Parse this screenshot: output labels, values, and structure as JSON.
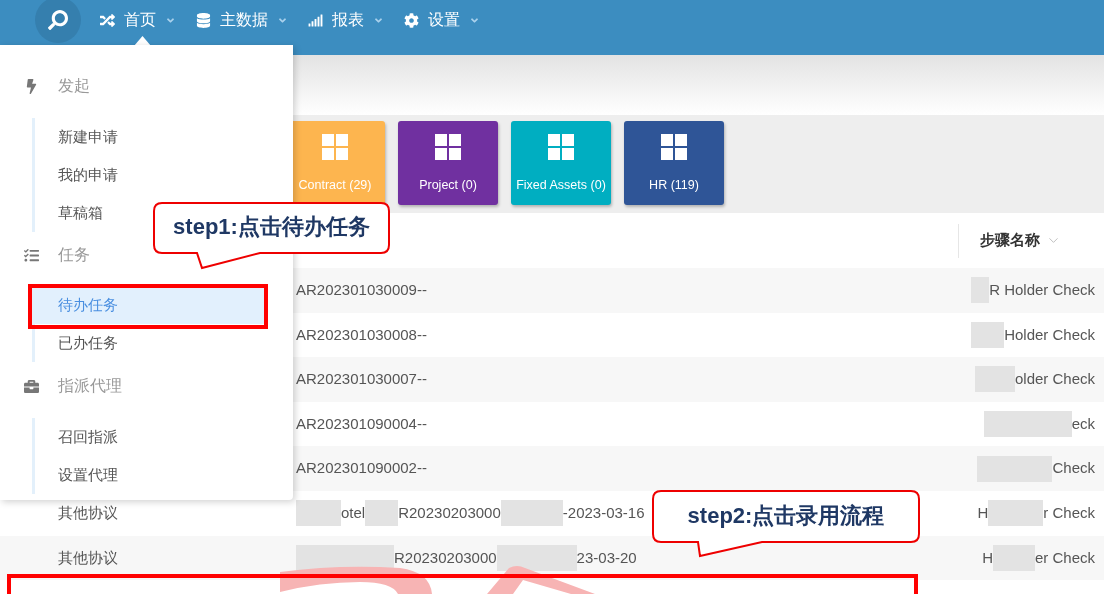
{
  "topbar": {
    "nav": [
      {
        "label": "首页"
      },
      {
        "label": "主数据"
      },
      {
        "label": "报表"
      },
      {
        "label": "设置"
      }
    ]
  },
  "dropdown": {
    "sections": [
      {
        "title": "发起",
        "items": [
          {
            "label": "新建申请",
            "selected": false
          },
          {
            "label": "我的申请",
            "selected": false
          },
          {
            "label": "草稿箱",
            "selected": false
          }
        ]
      },
      {
        "title": "任务",
        "items": [
          {
            "label": "待办任务",
            "selected": true
          },
          {
            "label": "已办任务",
            "selected": false
          }
        ]
      },
      {
        "title": "指派代理",
        "items": [
          {
            "label": "召回指派",
            "selected": false
          },
          {
            "label": "设置代理",
            "selected": false
          }
        ]
      }
    ]
  },
  "tiles": [
    {
      "label": "Contract (29)",
      "color": "#fdb54f"
    },
    {
      "label": "Project (0)",
      "color": "#7030a0"
    },
    {
      "label": "Fixed Assets (0)",
      "color": "#00aec1"
    },
    {
      "label": "HR (119)",
      "color": "#2f5597"
    }
  ],
  "table": {
    "columns": [
      {
        "label": "步骤名称"
      }
    ],
    "rows": [
      {
        "column_2": [
          {
            "kind": "text",
            "text": "AR202301030009--"
          }
        ],
        "step_name": [
          {
            "kind": "redacted"
          },
          {
            "kind": "text",
            "text": "R Holder Check"
          }
        ]
      },
      {
        "column_2": [
          {
            "kind": "text",
            "text": "AR202301030008--"
          }
        ],
        "step_name": [
          {
            "kind": "redacted"
          },
          {
            "kind": "text",
            "text": "Holder Check"
          }
        ]
      },
      {
        "column_2": [
          {
            "kind": "text",
            "text": "AR202301030007--"
          }
        ],
        "step_name": [
          {
            "kind": "redacted"
          },
          {
            "kind": "text",
            "text": "older Check"
          }
        ]
      },
      {
        "column_2": [
          {
            "kind": "text",
            "text": "AR202301090004--"
          }
        ],
        "step_name": [
          {
            "kind": "redacted"
          },
          {
            "kind": "text",
            "text": "eck"
          }
        ]
      },
      {
        "column_2": [
          {
            "kind": "text",
            "text": "AR202301090002--"
          }
        ],
        "step_name": [
          {
            "kind": "redacted"
          },
          {
            "kind": "text",
            "text": "Check"
          }
        ]
      },
      {
        "column_1": "其他协议",
        "column_2": [
          {
            "kind": "redacted"
          },
          {
            "kind": "text",
            "text": "otel"
          },
          {
            "kind": "redacted"
          },
          {
            "kind": "text",
            "text": "R20230203000"
          },
          {
            "kind": "redacted"
          },
          {
            "kind": "text",
            "text": "-2023-03-16"
          }
        ],
        "step_name": [
          {
            "kind": "text",
            "text": "H"
          },
          {
            "kind": "redacted"
          },
          {
            "kind": "text",
            "text": "r Check"
          }
        ]
      },
      {
        "column_1": "其他协议",
        "column_2": [
          {
            "kind": "redacted"
          },
          {
            "kind": "text",
            "text": "R20230203000"
          },
          {
            "kind": "redacted"
          },
          {
            "kind": "text",
            "text": "23-03-20"
          }
        ],
        "step_name": [
          {
            "kind": "text",
            "text": "H"
          },
          {
            "kind": "redacted"
          },
          {
            "kind": "text",
            "text": "er Check"
          }
        ]
      }
    ]
  },
  "annotations": [
    {
      "kind": "frame"
    },
    {
      "kind": "callout",
      "text": "step1:点击待办任务"
    },
    {
      "kind": "callout",
      "text": "step2:点击录用流程"
    },
    {
      "kind": "frame"
    }
  ]
}
